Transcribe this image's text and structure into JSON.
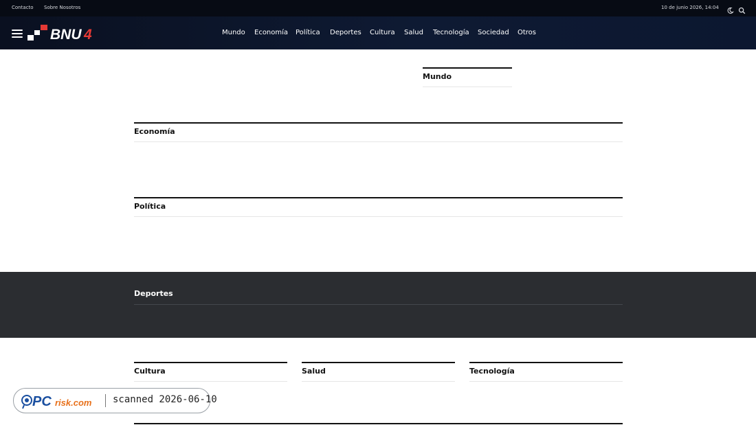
{
  "topbar": {
    "links": [
      "Contacto",
      "Sobre Nosotros"
    ],
    "date": "10 de junio 2026, 14:04",
    "icons": [
      "moon-icon",
      "search-icon"
    ]
  },
  "header": {
    "logo_text": "BNU4",
    "nav": [
      "Mundo",
      "Economía",
      "Política",
      "Deportes",
      "Cultura",
      "Salud",
      "Tecnología",
      "Sociedad",
      "Otros"
    ]
  },
  "sections": {
    "mundo": "Mundo",
    "economia": "Economía",
    "politica": "Política",
    "deportes": "Deportes",
    "cultura": "Cultura",
    "salud": "Salud",
    "tecnologia": "Tecnología"
  },
  "badge": {
    "brand": "PCrisk.com",
    "text": "scanned 2026-06-10"
  },
  "colors": {
    "header_bg": "#0e1a33",
    "topbar_bg": "#070b14",
    "dark_band": "#2b2d31",
    "accent": "#e53935"
  }
}
